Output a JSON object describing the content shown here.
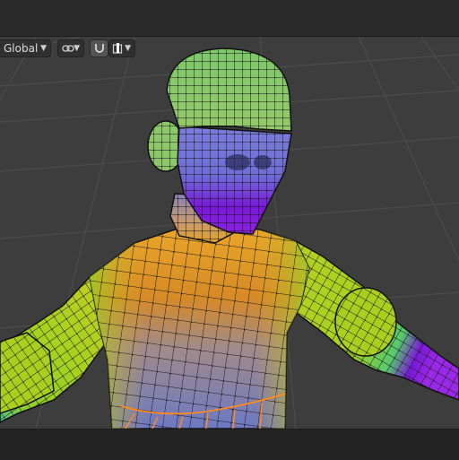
{
  "header": {
    "orientation": {
      "value": "Global",
      "icon": "chevron-down-icon"
    },
    "pivot": {
      "icon": "link-icon",
      "chevron": "chevron-down-icon"
    },
    "snap": {
      "toggle_icon": "magnet-icon",
      "target_icon": "snap-increment-icon",
      "chevron": "chevron-down-icon"
    }
  },
  "viewport": {
    "mode": "weight-paint-mesh",
    "grid_color": "#505050",
    "background_color": "#3d3d3d",
    "weight_colors": {
      "low": "#5a6bd6",
      "mid_low": "#6fd46f",
      "mid": "#a8d21f",
      "mid_high": "#f0a020",
      "high": "#7a18d8"
    },
    "selected_edge_color": "#ff8a1c"
  }
}
